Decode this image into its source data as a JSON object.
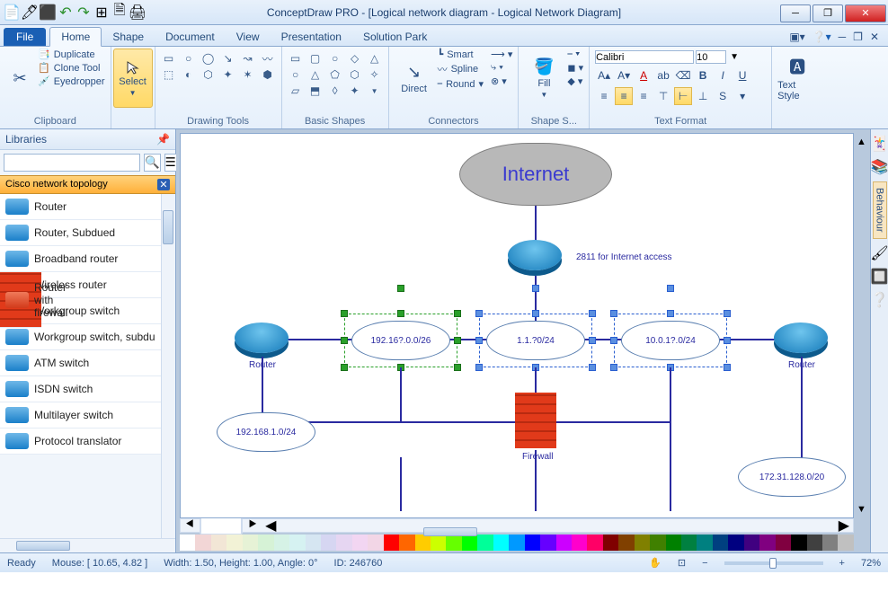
{
  "window": {
    "title": "ConceptDraw PRO - [Logical network diagram - Logical Network Diagram]"
  },
  "tabs": {
    "file": "File",
    "items": [
      "Home",
      "Shape",
      "Document",
      "View",
      "Presentation",
      "Solution Park"
    ],
    "active": 0
  },
  "ribbon": {
    "clipboard": {
      "label": "Clipboard",
      "duplicate": "Duplicate",
      "clone": "Clone Tool",
      "eyedropper": "Eyedropper"
    },
    "select": {
      "label": "Select"
    },
    "drawing": {
      "label": "Drawing Tools"
    },
    "basic": {
      "label": "Basic Shapes"
    },
    "connectors": {
      "label": "Connectors",
      "direct": "Direct",
      "smart": "Smart",
      "spline": "Spline",
      "round": "Round"
    },
    "fill": {
      "label": "Fill"
    },
    "shapestyle": {
      "label": "Shape S..."
    },
    "textformat": {
      "label": "Text Format",
      "font": "Calibri",
      "size": "10"
    },
    "textstyle": {
      "label": "Text Style"
    }
  },
  "library": {
    "title": "Libraries",
    "category": "Cisco network topology",
    "items": [
      {
        "label": "Router"
      },
      {
        "label": "Router, Subdued"
      },
      {
        "label": "Broadband router"
      },
      {
        "label": "Router with firewall",
        "cls": "firewall"
      },
      {
        "label": "Wireless router"
      },
      {
        "label": "Workgroup switch"
      },
      {
        "label": "Workgroup switch, subdu"
      },
      {
        "label": "ATM switch"
      },
      {
        "label": "ISDN switch"
      },
      {
        "label": "Multilayer switch"
      },
      {
        "label": "Protocol translator"
      }
    ]
  },
  "diagram": {
    "internet": "Internet",
    "note": "2811 for Internet access",
    "net1": "192.16?.0.0/26",
    "net2": "1.1.?0/24",
    "net3": "10.0.1?.0/24",
    "net4": "192.168.1.0/24",
    "net5": "172.31.128.0/20",
    "router_l": "Router",
    "router_r": "Router",
    "firewall": "Firewall"
  },
  "colorbar": [
    "#ffffff",
    "#f2d6d6",
    "#f2e6d6",
    "#f2f2d6",
    "#e6f2d6",
    "#d6f2d6",
    "#d6f2e6",
    "#d6f2f2",
    "#d6e6f2",
    "#d6d6f2",
    "#e6d6f2",
    "#f2d6f2",
    "#f2d6e6",
    "#ff0000",
    "#ff6600",
    "#ffcc00",
    "#ccff00",
    "#66ff00",
    "#00ff00",
    "#00ff99",
    "#00ffff",
    "#0099ff",
    "#0000ff",
    "#6600ff",
    "#cc00ff",
    "#ff00cc",
    "#ff0066",
    "#800000",
    "#804000",
    "#808000",
    "#408000",
    "#008000",
    "#008040",
    "#008080",
    "#004080",
    "#000080",
    "#400080",
    "#800080",
    "#800040",
    "#000000",
    "#404040",
    "#808080",
    "#c0c0c0"
  ],
  "status": {
    "ready": "Ready",
    "mouse": "Mouse: [ 10.65, 4.82 ]",
    "dims": "Width: 1.50,  Height: 1.00,  Angle: 0°",
    "id": "ID: 246760",
    "zoom": "72%"
  },
  "rside": {
    "behaviour": "Behaviour"
  }
}
